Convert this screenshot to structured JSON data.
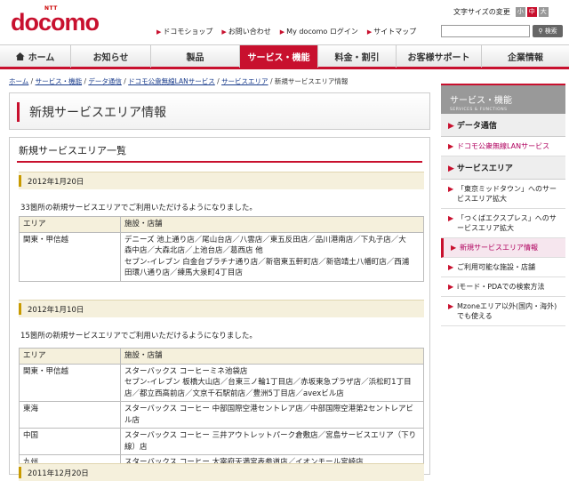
{
  "logo": {
    "ntt": "NTT",
    "name": "docomo"
  },
  "text_size": {
    "label": "文字サイズの変更",
    "small": "小",
    "medium": "中",
    "large": "大"
  },
  "top_links": [
    "ドコモショップ",
    "お問い合わせ",
    "My docomo ログイン",
    "サイトマップ"
  ],
  "search": {
    "placeholder": "",
    "button": "検索"
  },
  "gnav": [
    {
      "label": "ホーム",
      "w": 80
    },
    {
      "label": "お知らせ",
      "w": 90
    },
    {
      "label": "製品",
      "w": 100
    },
    {
      "label": "サービス・機能",
      "w": 88
    },
    {
      "label": "料金・割引",
      "w": 88
    },
    {
      "label": "お客様サポート",
      "w": 96
    },
    {
      "label": "企業情報",
      "w": 98
    }
  ],
  "breadcrumb": {
    "items": [
      "ホーム",
      "サービス・機能",
      "データ通信",
      "ドコモ公衆無線LANサービス",
      "サービスエリア"
    ],
    "current": "新規サービスエリア情報"
  },
  "page_title": "新規サービスエリア情報",
  "section_title": "新規サービスエリア一覧",
  "entries": [
    {
      "date": "2012年1月20日",
      "desc": "33箇所の新規サービスエリアでご利用いただけるようになりました。",
      "header": [
        "エリア",
        "施設・店舗"
      ],
      "rows": [
        {
          "area": "関東・甲信越",
          "lines": [
            "デニーズ 池上通り店／尾山台店／八雲店／東五反田店／品川港南店／下丸子店／大",
            "森中店／大森北店／上池台店／葛西店 他",
            "セブン-イレブン 白金台プラチナ通り店／新宿東五軒町店／新宿靖土八幡町店／西浦",
            "田環八通り店／練馬大泉町4丁目店"
          ]
        }
      ]
    },
    {
      "date": "2012年1月10日",
      "desc": "15箇所の新規サービスエリアでご利用いただけるようになりました。",
      "header": [
        "エリア",
        "施設・店舗"
      ],
      "rows": [
        {
          "area": "関東・甲信越",
          "lines": [
            "スターバックス コーヒーミネ池袋店",
            "セブン-イレブン 板橋大山店／台東三ノ輪1丁目店／赤坂東急プラザ店／浜松町1丁目",
            "店／都立西高前店／文京千石駅前店／豊洲5丁目店／avexビル店"
          ]
        },
        {
          "area": "東海",
          "lines": [
            "スターバックス コーヒー 中部国際空港セントレア店／中部国際空港第2セントレアビル店"
          ]
        },
        {
          "area": "中国",
          "lines": [
            "スターバックス コーヒー 三井アウトレットパーク倉敷店／宮島サービスエリア（下り線）店"
          ]
        },
        {
          "area": "九州",
          "lines": [
            "スターバックス コーヒー 太宰府天満宮表参道店／イオンモール宮崎店"
          ]
        }
      ]
    }
  ],
  "next_date": "2011年12月20日",
  "sidebar": {
    "title": "サービス・機能",
    "subtitle": "SERVICES & FUNCTIONS",
    "cat1": "データ通信",
    "item1": "ドコモ公衆無線LANサービス",
    "cat2": "サービスエリア",
    "items": [
      "「東京ミッドタウン」へのサービスエリア拡大",
      "「つくばエクスプレス」へのサービスエリア拡大",
      "新規サービスエリア情報",
      "ご利用可能な施設・店舗",
      "iモード・PDAでの検索方法",
      "Mzoneエリア以外(国内・海外)でも使える"
    ]
  },
  "colors": {
    "brand": "#c8102e"
  }
}
